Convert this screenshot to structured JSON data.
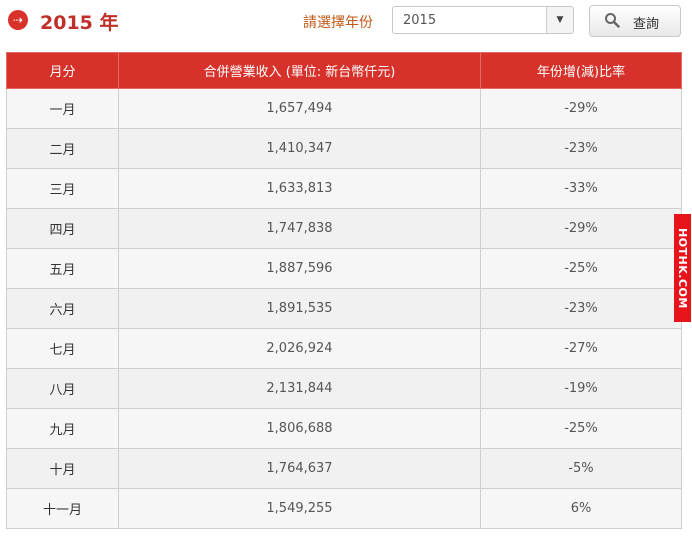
{
  "header": {
    "title": "2015 年",
    "year_label": "請選擇年份",
    "selected_year": "2015",
    "query_label": "查詢"
  },
  "table": {
    "headers": [
      "月分",
      "合併營業收入 (單位: 新台幣仟元)",
      "年份增(減)比率"
    ],
    "rows": [
      {
        "month": "一月",
        "revenue": "1,657,494",
        "change": "-29%"
      },
      {
        "month": "二月",
        "revenue": "1,410,347",
        "change": "-23%"
      },
      {
        "month": "三月",
        "revenue": "1,633,813",
        "change": "-33%"
      },
      {
        "month": "四月",
        "revenue": "1,747,838",
        "change": "-29%"
      },
      {
        "month": "五月",
        "revenue": "1,887,596",
        "change": "-25%"
      },
      {
        "month": "六月",
        "revenue": "1,891,535",
        "change": "-23%"
      },
      {
        "month": "七月",
        "revenue": "2,026,924",
        "change": "-27%"
      },
      {
        "month": "八月",
        "revenue": "2,131,844",
        "change": "-19%"
      },
      {
        "month": "九月",
        "revenue": "1,806,688",
        "change": "-25%"
      },
      {
        "month": "十月",
        "revenue": "1,764,637",
        "change": "-5%"
      },
      {
        "month": "十一月",
        "revenue": "1,549,255",
        "change": "6%"
      }
    ]
  },
  "watermark": "HOTHK.COM",
  "colors": {
    "accent": "#d6312a",
    "label": "#c05a1a"
  }
}
